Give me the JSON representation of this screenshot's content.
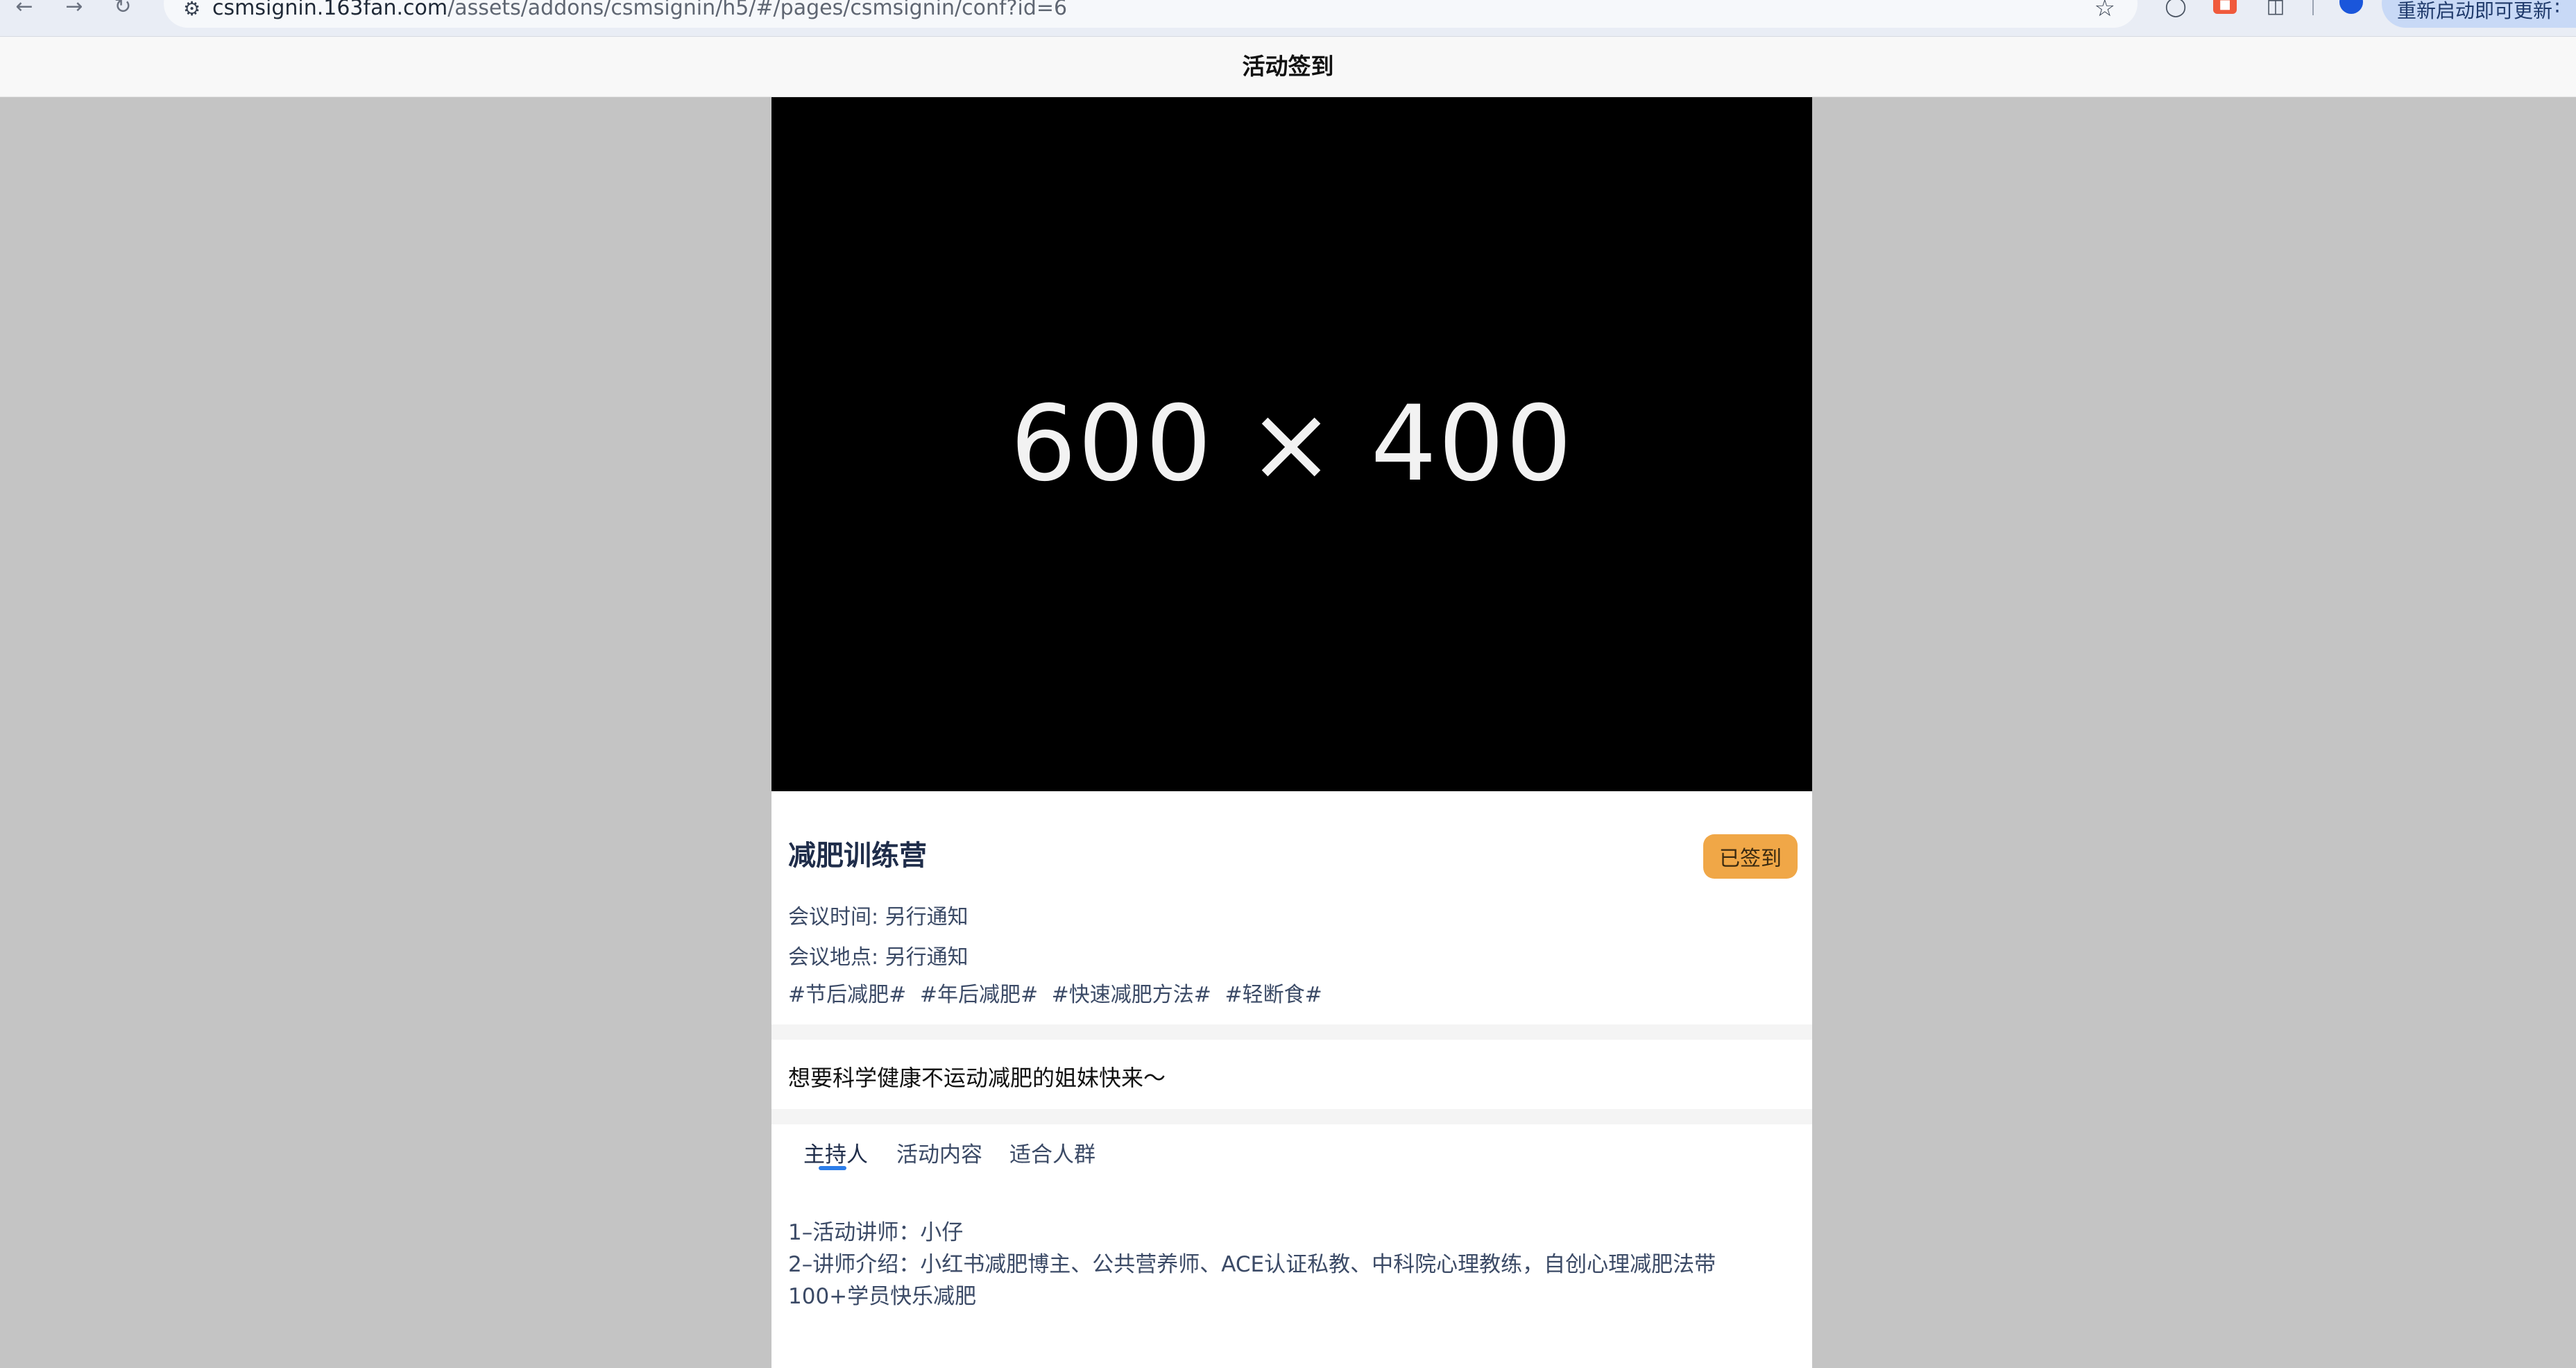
{
  "browser": {
    "url_host": "csmsignin.163fan.com",
    "url_path": "/assets/addons/csmsignin/h5/#/pages/csmsignin/conf?id=6",
    "update_label": "重新启动即可更新",
    "icons": [
      "back-icon",
      "forward-icon",
      "reload-icon",
      "site-settings-icon",
      "bookmark-star-icon",
      "extension-icon",
      "extension-red-icon",
      "puzzle-icon",
      "profile-icon",
      "kebab-icon"
    ]
  },
  "header": {
    "title": "活动签到"
  },
  "banner": {
    "placeholder": "600 × 400"
  },
  "event": {
    "title": "减肥训练营",
    "status_button": "已签到",
    "time_line": "会议时间: 另行通知",
    "place_line": "会议地点: 另行通知",
    "tags": [
      "#节后减肥#",
      "#年后减肥#",
      "#快速减肥方法#",
      "#轻断食#"
    ],
    "description": "想要科学健康不运动减肥的姐妹快来～"
  },
  "tabs": [
    {
      "label": "主持人",
      "active": true
    },
    {
      "label": "活动内容",
      "active": false
    },
    {
      "label": "适合人群",
      "active": false
    }
  ],
  "host_content": {
    "line1": "1–活动讲师：小仔",
    "line2": "2–讲师介绍：小红书减肥博主、公共营养师、ACE认证私教、中科院心理教练，自创心理减肥法带",
    "line3": "100+学员快乐减肥"
  },
  "colors": {
    "page_bg": "#c4c4c4",
    "button_bg": "#f0a747",
    "tab_accent": "#2b7de9",
    "title_color": "#1f2d4a"
  }
}
